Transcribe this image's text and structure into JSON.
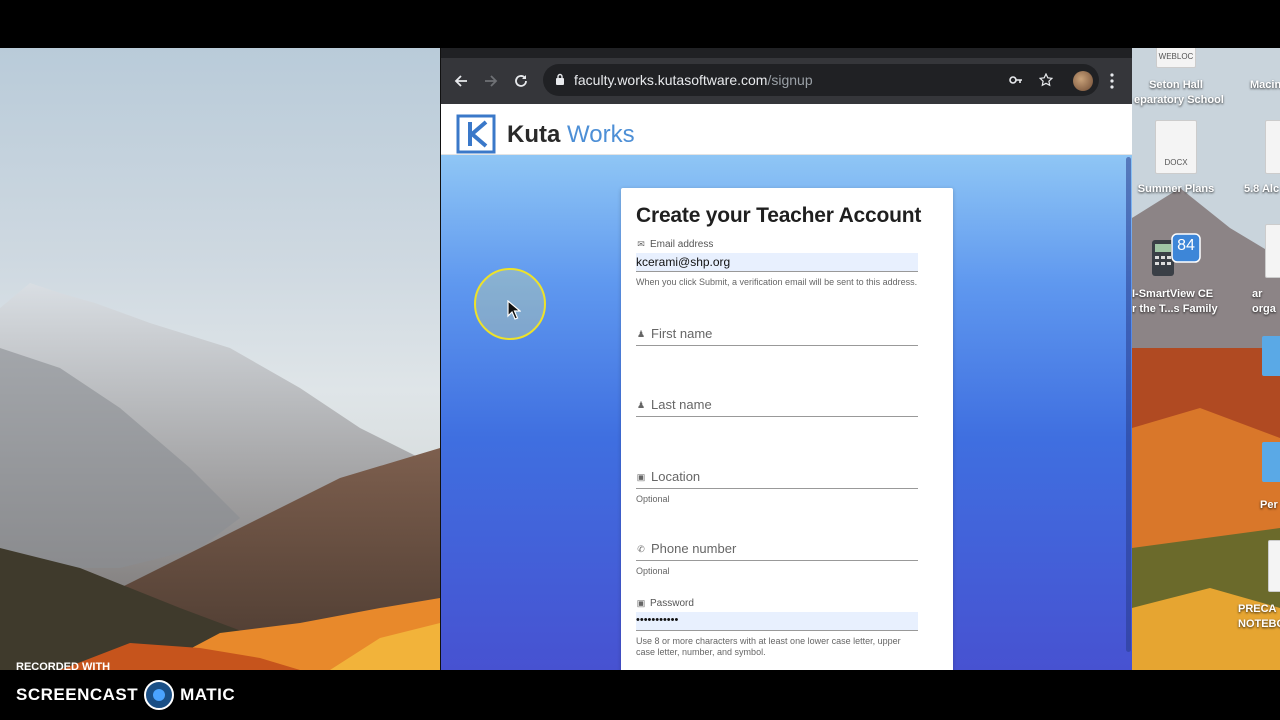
{
  "browser": {
    "url_domain": "faculty.works.kutasoftware.com",
    "url_path": "/signup"
  },
  "site": {
    "logo_brand": "Kuta",
    "logo_accent": "Works"
  },
  "form": {
    "title": "Create your Teacher Account",
    "email": {
      "label": "Email address",
      "value": "kcerami@shp.org",
      "hint": "When you click Submit, a verification email will be sent to this address."
    },
    "first_name": {
      "placeholder": "First name"
    },
    "last_name": {
      "placeholder": "Last name"
    },
    "location": {
      "placeholder": "Location",
      "hint": "Optional"
    },
    "phone": {
      "placeholder": "Phone number",
      "hint": "Optional"
    },
    "password": {
      "label": "Password",
      "value": "•••••••••••",
      "hint": "Use 8 or more characters with at least one lower case letter, upper case letter, number, and symbol."
    }
  },
  "desktop_icons": [
    {
      "label_line1": "WEBLOC",
      "kind": "webloc"
    },
    {
      "label_line1": "Seton Hall",
      "label_line2": "eparatory School"
    },
    {
      "label_line1": "Macin"
    },
    {
      "label_line1": "DOCX",
      "kind": "docx"
    },
    {
      "label_line1": "Summer Plans"
    },
    {
      "label_line1": "5.8 Alc"
    },
    {
      "label_line1": "84",
      "kind": "calculator-badge"
    },
    {
      "label_line1": "I-SmartView CE",
      "label_line2": "r the T...s Family"
    },
    {
      "label_line1": "ar",
      "label_line2": "orga"
    },
    {
      "label_line1": "Per"
    },
    {
      "label_line1": "PRECA",
      "label_line2": "NOTEBO"
    }
  ],
  "watermark": {
    "recorded_with": "RECORDED WITH",
    "brand_left": "SCREENCAST",
    "brand_right": "MATIC"
  }
}
